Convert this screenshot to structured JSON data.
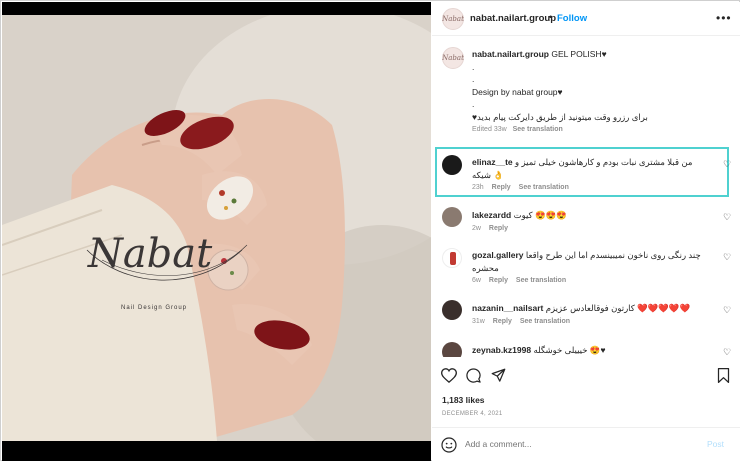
{
  "photo": {
    "logo_text": "Nabat",
    "logo_sub": "Nail Design Group"
  },
  "header": {
    "avatar_text": "Nabat",
    "username": "nabat.nailart.group",
    "dot": "•",
    "follow_label": "Follow",
    "more_icon": "more-dots-icon"
  },
  "caption": {
    "username": "nabat.nailart.group",
    "line1": "GEL POLISH♥",
    "line2": ".",
    "line3": ".",
    "line4": "Design by nabat group♥",
    "line5": ".",
    "line6": "برای رزرو وقت میتونید از طریق دایرکت پیام بدید♥",
    "edited": "Edited",
    "time": "33w",
    "see_translation": "See translation"
  },
  "comments": [
    {
      "username": "elinaz__te",
      "text": "من قبلا مشتری نبات بودم و کارهاشون خیلی تمیز و شیکه 👌",
      "time": "23h",
      "reply": "Reply",
      "see_translation": "See translation",
      "avatar_color": "#1a1a1a"
    },
    {
      "username": "lakezardd",
      "text": "کیوت 😍😍😍",
      "time": "2w",
      "reply": "Reply",
      "avatar_color": "#8a7a70"
    },
    {
      "username": "gozal.gallery",
      "text": "چند رنگی روی ناخون نمیبینسدم اما این طرح واقعا محشره",
      "time": "6w",
      "reply": "Reply",
      "see_translation": "See translation",
      "avatar_color": "#c23a32"
    },
    {
      "username": "nazanin__nailsart",
      "text": "کارتون فوقالعادس عزیزم ❤️❤️❤️❤️❤️",
      "time": "31w",
      "reply": "Reply",
      "see_translation": "See translation",
      "avatar_color": "#3a2f2c"
    },
    {
      "username": "zeynab.kz1998",
      "text": "خیییلی خوشگله 😍♥",
      "avatar_color": "#5a4640"
    }
  ],
  "actions": {
    "like_icon": "heart-outline-icon",
    "comment_icon": "comment-icon",
    "share_icon": "paper-plane-icon",
    "save_icon": "bookmark-icon"
  },
  "likes": "1,183 likes",
  "date": "DECEMBER 4, 2021",
  "add_comment": {
    "placeholder": "Add a comment...",
    "emoji_icon": "smiley-icon",
    "post_label": "Post"
  },
  "colors": {
    "accent": "#0095f6",
    "highlight": "#4fd1d0",
    "nail_red": "#7e1418"
  }
}
